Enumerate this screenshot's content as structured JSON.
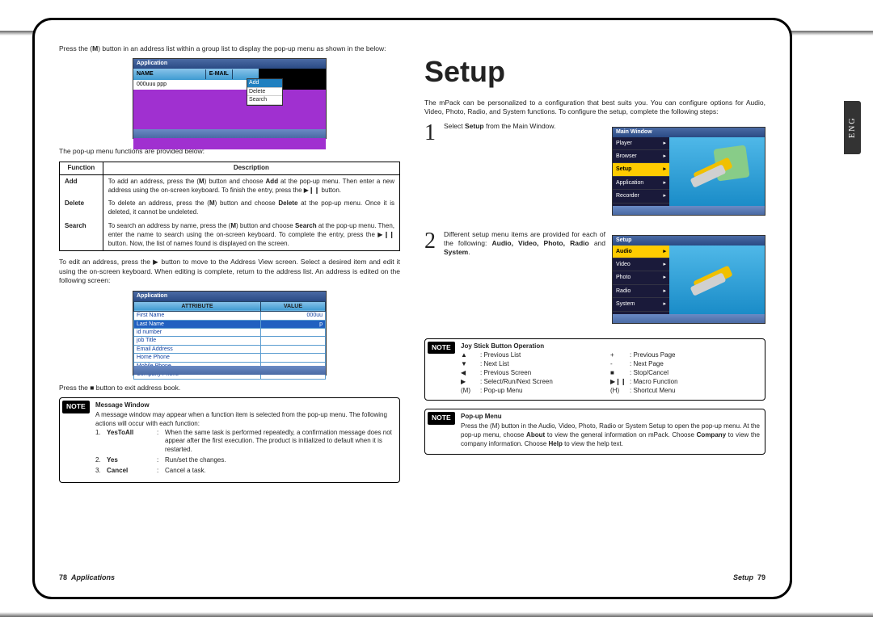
{
  "sideTab": "ENG",
  "left": {
    "p1_a": "Press the (",
    "p1_b": ") button in an address list within a group list to display the pop-up menu as shown in the below:",
    "m_key": "M",
    "ss1": {
      "topbar": "Application",
      "h1": "NAME",
      "h2": "E-MAIL",
      "row": "000uuu ppp",
      "pop": [
        "Add",
        "Delete",
        "Search"
      ]
    },
    "p2": "The pop-up menu functions are provided below:",
    "tbl_h1": "Function",
    "tbl_h2": "Description",
    "fn": [
      {
        "name": "Add",
        "desc_a": "To add an address, press the (",
        "desc_b": ") button and choose ",
        "desc_c": " at the pop-up menu. Then enter a new address using the on-screen keyboard. To finish the entry, press the ▶❙❙ button.",
        "bold": "Add"
      },
      {
        "name": "Delete",
        "desc_a": "To delete an address, press the (",
        "desc_b": ") button and choose ",
        "desc_c": " at the pop-up menu. Once it is deleted, it cannot be undeleted.",
        "bold": "Delete"
      },
      {
        "name": "Search",
        "desc_a": "To search an address by name, press the (",
        "desc_b": ") button and choose ",
        "desc_c": " at the pop-up menu. Then, enter the name to search using the on-screen keyboard. To complete the entry, press the ▶❙❙ button. Now, the list of names found is displayed on the screen.",
        "bold": "Search"
      }
    ],
    "p3": "To edit an address, press the ▶ button to move to the Address View screen. Select a desired item and edit it using the on-screen keyboard. When editing is complete, return to the address list. An address is edited on the following screen:",
    "ss2": {
      "topbar": "Application",
      "h1": "ATTRIBUTE",
      "h2": "VALUE",
      "rows": [
        [
          "First Name",
          "000uu"
        ],
        [
          "Last Name",
          "p"
        ],
        [
          "id number",
          ""
        ],
        [
          "job Title",
          ""
        ],
        [
          "Email Address",
          ""
        ],
        [
          "Home Phone",
          ""
        ],
        [
          "Mobile Phone",
          ""
        ],
        [
          "Company Phone",
          ""
        ]
      ],
      "selIndex": 1
    },
    "p4": "Press the ■ button to exit address book.",
    "note": {
      "tag": "NOTE",
      "hd": "Message Window",
      "txt": "A message window may appear when a function item is selected from the pop-up menu. The following actions will occur with each function:",
      "items": [
        {
          "n": "1.",
          "k": "YesToAll",
          "c": ":",
          "d": "When the same task is performed repeatedly, a confirmation message does not appear after the first execution. The product is initialized to default when it is restarted."
        },
        {
          "n": "2.",
          "k": "Yes",
          "c": ":",
          "d": "Run/set the changes."
        },
        {
          "n": "3.",
          "k": "Cancel",
          "c": ":",
          "d": "Cancel a task."
        }
      ]
    },
    "footer_page": "78",
    "footer_title": "Applications"
  },
  "right": {
    "title": "Setup",
    "intro": "The mPack can be personalized to a configuration that best suits you. You can configure options for Audio, Video, Photo, Radio, and System functions. To configure the setup, complete the following steps:",
    "step1_a": "Select ",
    "step1_bold": "Setup",
    "step1_b": " from the Main Window.",
    "ss3": {
      "topbar": "Main Window",
      "items": [
        "Player",
        "Browser",
        "Setup",
        "Application",
        "Recorder"
      ],
      "selIndex": 2
    },
    "step2_a": "Different setup menu items are provided for each of the following: ",
    "step2_bold": "Audio, Video, Photo, Radio",
    "step2_mid": " and ",
    "step2_bold2": "System",
    "step2_end": ".",
    "ss4": {
      "topbar": "Setup",
      "items": [
        "Audio",
        "Video",
        "Photo",
        "Radio",
        "System"
      ],
      "selIndex": 0
    },
    "note1": {
      "tag": "NOTE",
      "hd": "Joy Stick Button Operation",
      "rowsL": [
        [
          "▲",
          ": Previous List"
        ],
        [
          "▼",
          ": Next List"
        ],
        [
          "◀",
          ": Previous Screen"
        ],
        [
          "▶",
          ": Select/Run/Next Screen"
        ],
        [
          "(M)",
          ": Pop-up Menu"
        ]
      ],
      "rowsR": [
        [
          "+",
          ": Previous Page"
        ],
        [
          "-",
          ": Next Page"
        ],
        [
          "■",
          ": Stop/Cancel"
        ],
        [
          "▶❙❙",
          ": Macro Function"
        ],
        [
          "(H)",
          ": Shortcut Menu"
        ]
      ]
    },
    "note2": {
      "tag": "NOTE",
      "hd": "Pop-up Menu",
      "txt_a": "Press the (M) button in the Audio, Video, Photo, Radio or System Setup to open the pop-up menu. At the pop-up menu, choose ",
      "b1": "About",
      "txt_b": " to view the general information on mPack. Choose ",
      "b2": "Company",
      "txt_c": " to view the company information. Choose ",
      "b3": "Help",
      "txt_d": " to view the help text."
    },
    "footer_title": "Setup",
    "footer_page": "79"
  }
}
